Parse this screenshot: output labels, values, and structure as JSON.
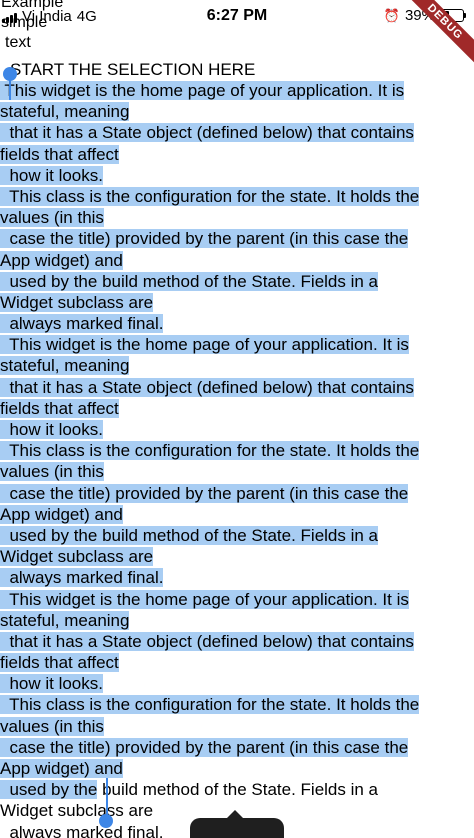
{
  "status_bar": {
    "carrier": "Vi India",
    "network": "4G",
    "time": "6:27 PM",
    "battery": "39%",
    "icons": [
      "signal-icon",
      "alarm-icon",
      "battery-icon"
    ]
  },
  "debug_banner": "DEBUG",
  "header_lines": [
    "Example",
    "simple",
    "text"
  ],
  "start_label": "START THE SELECTION HERE",
  "text_lines": [
    " This widget is the home page of your application. It is",
    "stateful, meaning",
    "  that it has a State object (defined below) that contains",
    "fields that affect",
    "  how it looks.",
    "  This class is the configuration for the state. It holds the",
    "values (in this",
    "  case the title) provided by the parent (in this case the",
    "App widget) and",
    "  used by the build method of the State. Fields in a",
    "Widget subclass are",
    "  always marked final.",
    "  This widget is the home page of your application. It is",
    "stateful, meaning",
    "  that it has a State object (defined below) that contains",
    "fields that affect",
    "  how it looks.",
    "  This class is the configuration for the state. It holds the",
    "values (in this",
    "  case the title) provided by the parent (in this case the",
    "App widget) and",
    "  used by the build method of the State. Fields in a",
    "Widget subclass are",
    "  always marked final.",
    "  This widget is the home page of your application. It is",
    "stateful, meaning",
    "  that it has a State object (defined below) that contains",
    "fields that affect",
    "  how it looks.",
    "  This class is the configuration for the state. It holds the",
    "values (in this",
    "  case the title) provided by the parent (in this case the",
    "App widget) and",
    "  used by the build method of the State. Fields in a",
    "Widget subclass are",
    "  always marked final."
  ],
  "selection_end": {
    "line": 33,
    "char": 13
  },
  "colors": {
    "selection": "#a8cdf3",
    "handle": "#3d86e6",
    "debug_banner": "#a02929",
    "popup": "#1f1f1f"
  }
}
